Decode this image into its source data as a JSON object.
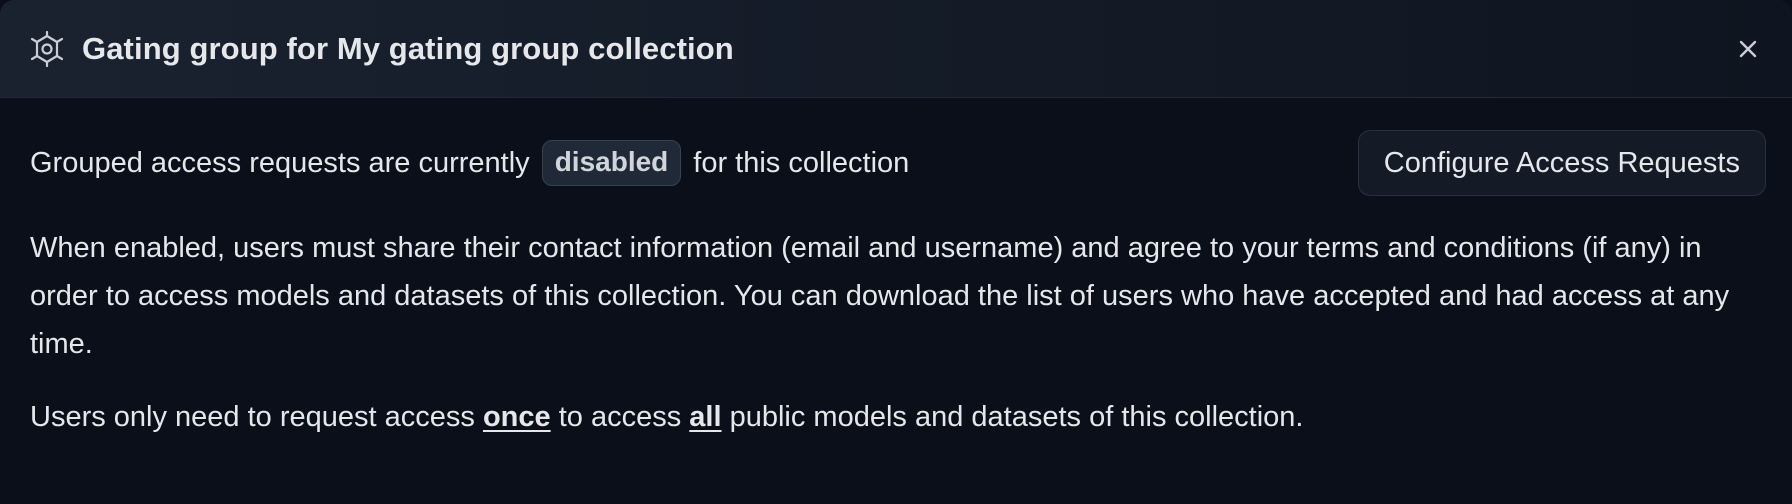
{
  "header": {
    "title": "Gating group for My gating group collection",
    "icon": "gating-group-icon",
    "close_icon": "close-icon"
  },
  "status": {
    "prefix": "Grouped access requests are currently",
    "badge": "disabled",
    "suffix": "for this collection",
    "configure_label": "Configure Access Requests"
  },
  "description": "When enabled, users must share their contact information (email and username) and agree to your terms and conditions (if any) in order to access models and datasets of this collection. You can download the list of users who have accepted and had access at any time.",
  "note": {
    "part1": "Users only need to request access",
    "emph1": "once",
    "part2": "to access",
    "emph2": "all",
    "part3": "public models and datasets of this collection."
  },
  "colors": {
    "background": "#0b0f19",
    "header_bg": "#1a2230",
    "text": "#e5e7eb",
    "badge_bg": "#1f2937"
  }
}
